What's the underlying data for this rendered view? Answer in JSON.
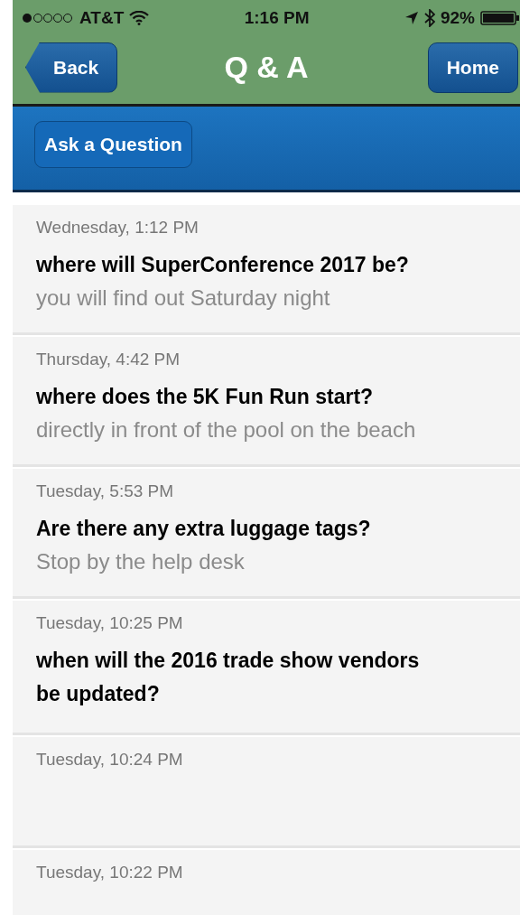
{
  "status_bar": {
    "carrier": "AT&T",
    "time": "1:16 PM",
    "battery": "92%"
  },
  "nav": {
    "back": "Back",
    "title": "Q & A",
    "home": "Home"
  },
  "toolbar": {
    "ask_button": "Ask a Question"
  },
  "questions": [
    {
      "date": "Wednesday, 1:12 PM",
      "question": "where will SuperConference 2017 be?",
      "answer": "you will find out Saturday night"
    },
    {
      "date": "Thursday, 4:42 PM",
      "question": "where does the 5K Fun Run start?",
      "answer": "directly in front of the pool on the beach"
    },
    {
      "date": "Tuesday, 5:53 PM",
      "question": "Are there any extra luggage tags?",
      "answer": "Stop by the help desk"
    },
    {
      "date": "Tuesday, 10:25 PM",
      "question": "when will the 2016 trade show vendors be updated?"
    },
    {
      "date": "Tuesday, 10:24 PM"
    },
    {
      "date": "Tuesday, 10:22 PM"
    }
  ]
}
